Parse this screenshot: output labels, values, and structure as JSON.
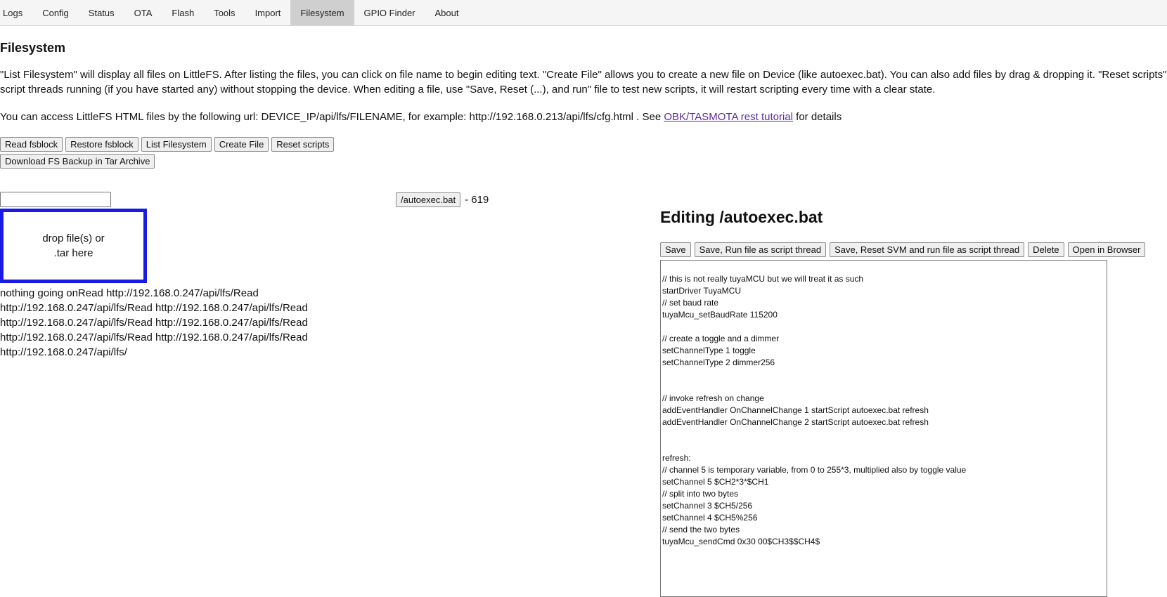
{
  "tabs": [
    {
      "label": "Logs"
    },
    {
      "label": "Config"
    },
    {
      "label": "Status"
    },
    {
      "label": "OTA"
    },
    {
      "label": "Flash"
    },
    {
      "label": "Tools"
    },
    {
      "label": "Import"
    },
    {
      "label": "Filesystem",
      "active": true
    },
    {
      "label": "GPIO Finder"
    },
    {
      "label": "About"
    }
  ],
  "page": {
    "heading": "Filesystem",
    "description_line1": "\"List Filesystem\" will display all files on LittleFS. After listing the files, you can click on file name to begin editing text. \"Create File\" allows you to create a new file on Device (like autoexec.bat). You can also add files by drag & dropping it. \"Reset scripts\" will clear all",
    "description_line2": "script threads running (if you have started any) without stopping the device. When editing a file, use \"Save, Reset (...), and run\" file to test new scripts, it will restart scripting every time with a clear state.",
    "url_text": "You can access LittleFS HTML files by the following url: DEVICE_IP/api/lfs/FILENAME, for example: http://192.168.0.213/api/lfs/cfg.html . See ",
    "url_link": "OBK/TASMOTA rest tutorial",
    "url_suffix": " for details"
  },
  "buttons": {
    "read_fsblock": "Read fsblock",
    "restore_fsblock": "Restore fsblock",
    "list_filesystem": "List Filesystem",
    "create_file": "Create File",
    "reset_scripts": "Reset scripts",
    "download_backup": "Download FS Backup in Tar Archive"
  },
  "file_list": {
    "filter_value": "",
    "file_name": "/autoexec.bat",
    "file_size": "- 619"
  },
  "dropzone": {
    "line1": "drop file(s) or",
    "line2": ".tar here"
  },
  "log": {
    "lines": [
      "nothing going onRead http://192.168.0.247/api/lfs/Read",
      "http://192.168.0.247/api/lfs/Read http://192.168.0.247/api/lfs/Read",
      "http://192.168.0.247/api/lfs/Read http://192.168.0.247/api/lfs/Read",
      "http://192.168.0.247/api/lfs/Read http://192.168.0.247/api/lfs/Read",
      "http://192.168.0.247/api/lfs/"
    ]
  },
  "editor": {
    "title": "Editing /autoexec.bat",
    "buttons": {
      "save": "Save",
      "save_run": "Save, Run file as script thread",
      "save_reset_run": "Save, Reset SVM and run file as script thread",
      "delete": "Delete",
      "open_browser": "Open in Browser"
    },
    "lines": [
      "// this is not really tuyaMCU but we will treat it as such",
      "startDriver TuyaMCU",
      "// set baud rate",
      "tuyaMcu_setBaudRate 115200",
      "",
      "// create a toggle and a dimmer",
      "setChannelType 1 toggle",
      "setChannelType 2 dimmer256",
      "",
      "",
      "// invoke refresh on change",
      "addEventHandler OnChannelChange 1 startScript autoexec.bat refresh",
      "addEventHandler OnChannelChange 2 startScript autoexec.bat refresh",
      "",
      "",
      "refresh:",
      "// channel 5 is temporary variable, from 0 to 255*3, multiplied also by toggle value",
      "setChannel 5 $CH2*3*$CH1",
      "// split into two bytes",
      "setChannel 3 $CH5/256",
      "setChannel 4 $CH5%256",
      "// send the two bytes",
      "tuyaMcu_sendCmd 0x30 00$CH3$$CH4$"
    ]
  }
}
